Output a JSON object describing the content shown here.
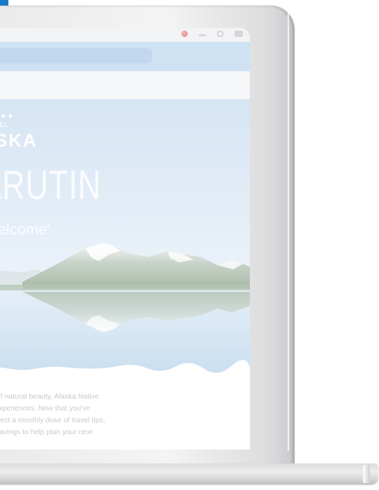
{
  "browser": {
    "window_icons": [
      "extension-icon",
      "minimize-icon",
      "maximize-icon",
      "close-icon"
    ]
  },
  "hero": {
    "brand": {
      "travel": "TRAVEL",
      "name": "ASKA"
    },
    "name": "ARUTIN",
    "greeting": "'Welcome'"
  },
  "body": {
    "lines": [
      "land of natural beauty, Alaska Native",
      "and experiences. Now that you've",
      "s, expect a monthly dose of travel tips,",
      "sive savings to help plan your next"
    ]
  },
  "colors": {
    "toolbar": "#cfe2f4",
    "hero_sky": "#dbe8f5",
    "text_white": "#ffffff",
    "body_text": "#c9c9cc"
  }
}
